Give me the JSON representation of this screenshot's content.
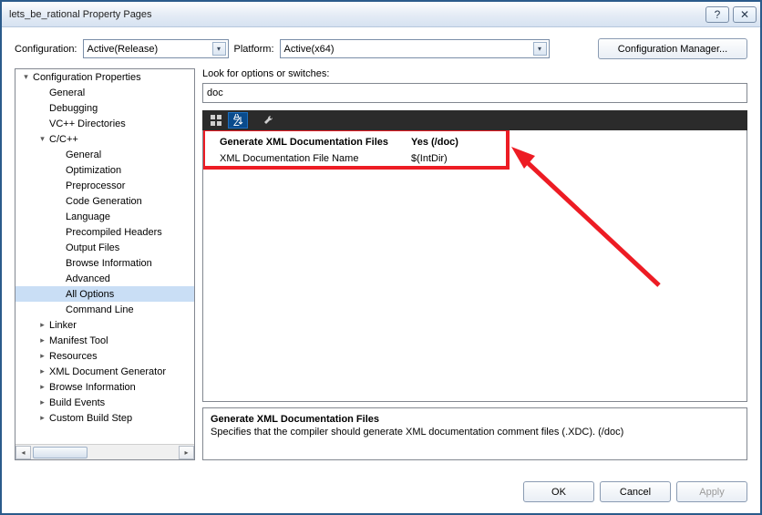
{
  "title": "lets_be_rational Property Pages",
  "configRow": {
    "configLabel": "Configuration:",
    "configValue": "Active(Release)",
    "platformLabel": "Platform:",
    "platformValue": "Active(x64)",
    "managerBtn": "Configuration Manager..."
  },
  "tree": [
    {
      "indent": 0,
      "exp": "▾",
      "label": "Configuration Properties"
    },
    {
      "indent": 1,
      "exp": "",
      "label": "General"
    },
    {
      "indent": 1,
      "exp": "",
      "label": "Debugging"
    },
    {
      "indent": 1,
      "exp": "",
      "label": "VC++ Directories"
    },
    {
      "indent": 1,
      "exp": "▾",
      "label": "C/C++"
    },
    {
      "indent": 2,
      "exp": "",
      "label": "General"
    },
    {
      "indent": 2,
      "exp": "",
      "label": "Optimization"
    },
    {
      "indent": 2,
      "exp": "",
      "label": "Preprocessor"
    },
    {
      "indent": 2,
      "exp": "",
      "label": "Code Generation"
    },
    {
      "indent": 2,
      "exp": "",
      "label": "Language"
    },
    {
      "indent": 2,
      "exp": "",
      "label": "Precompiled Headers"
    },
    {
      "indent": 2,
      "exp": "",
      "label": "Output Files"
    },
    {
      "indent": 2,
      "exp": "",
      "label": "Browse Information"
    },
    {
      "indent": 2,
      "exp": "",
      "label": "Advanced"
    },
    {
      "indent": 2,
      "exp": "",
      "label": "All Options",
      "sel": true
    },
    {
      "indent": 2,
      "exp": "",
      "label": "Command Line"
    },
    {
      "indent": 1,
      "exp": "▸",
      "label": "Linker"
    },
    {
      "indent": 1,
      "exp": "▸",
      "label": "Manifest Tool"
    },
    {
      "indent": 1,
      "exp": "▸",
      "label": "Resources"
    },
    {
      "indent": 1,
      "exp": "▸",
      "label": "XML Document Generator"
    },
    {
      "indent": 1,
      "exp": "▸",
      "label": "Browse Information"
    },
    {
      "indent": 1,
      "exp": "▸",
      "label": "Build Events"
    },
    {
      "indent": 1,
      "exp": "▸",
      "label": "Custom Build Step"
    }
  ],
  "searchLabel": "Look for options or switches:",
  "searchValue": "doc",
  "gridRows": [
    {
      "k": "Generate XML Documentation Files",
      "v": "Yes (/doc)",
      "bold": true
    },
    {
      "k": "XML Documentation File Name",
      "v": "$(IntDir)",
      "bold": false
    }
  ],
  "desc": {
    "title": "Generate XML Documentation Files",
    "body": "Specifies that the compiler should generate XML documentation comment files (.XDC).     (/doc)"
  },
  "buttons": {
    "ok": "OK",
    "cancel": "Cancel",
    "apply": "Apply"
  }
}
